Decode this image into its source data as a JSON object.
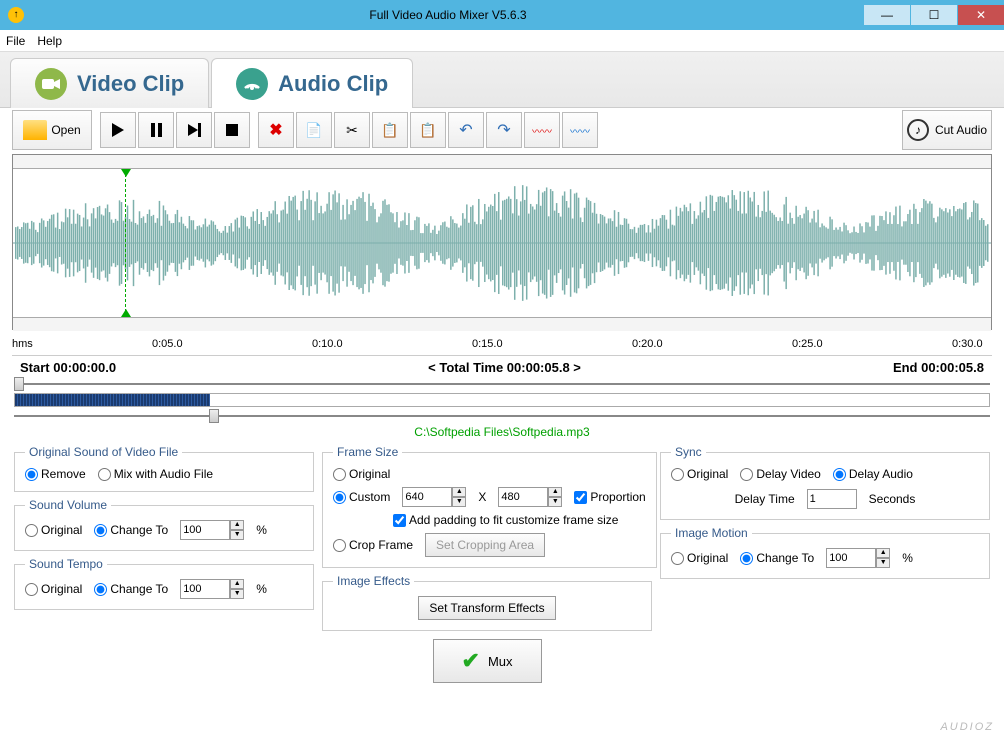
{
  "titlebar": {
    "title": "Full Video Audio Mixer V5.6.3"
  },
  "menu": {
    "file": "File",
    "help": "Help"
  },
  "tabs": {
    "video": "Video Clip",
    "audio": "Audio Clip"
  },
  "toolbar": {
    "open": "Open",
    "cut_audio": "Cut Audio"
  },
  "time_ruler": {
    "hms": "hms",
    "ticks": [
      "0:05.0",
      "0:10.0",
      "0:15.0",
      "0:20.0",
      "0:25.0",
      "0:30.0"
    ]
  },
  "time_info": {
    "start": "Start 00:00:00.0",
    "total": "< Total Time 00:00:05.8 >",
    "end": "End 00:00:05.8"
  },
  "file_path": "C:\\Softpedia Files\\Softpedia.mp3",
  "settings": {
    "orig_sound": {
      "legend": "Original Sound of Video File",
      "remove": "Remove",
      "mix": "Mix with Audio File"
    },
    "volume": {
      "legend": "Sound Volume",
      "original": "Original",
      "change_to": "Change To",
      "value": "100",
      "suffix": "%"
    },
    "tempo": {
      "legend": "Sound Tempo",
      "original": "Original",
      "change_to": "Change To",
      "value": "100",
      "suffix": "%"
    },
    "frame": {
      "legend": "Frame Size",
      "original": "Original",
      "custom": "Custom",
      "w": "640",
      "x": "X",
      "h": "480",
      "proportion": "Proportion",
      "padding": "Add padding to fit customize frame size",
      "crop": "Crop Frame",
      "set_crop": "Set Cropping Area"
    },
    "effects": {
      "legend": "Image Effects",
      "set": "Set Transform Effects"
    },
    "sync": {
      "legend": "Sync",
      "original": "Original",
      "delay_video": "Delay Video",
      "delay_audio": "Delay Audio",
      "delay_time": "Delay Time",
      "value": "1",
      "seconds": "Seconds"
    },
    "motion": {
      "legend": "Image Motion",
      "original": "Original",
      "change_to": "Change To",
      "value": "100",
      "suffix": "%"
    },
    "mux": "Mux"
  },
  "watermark": "AUDIOZ"
}
